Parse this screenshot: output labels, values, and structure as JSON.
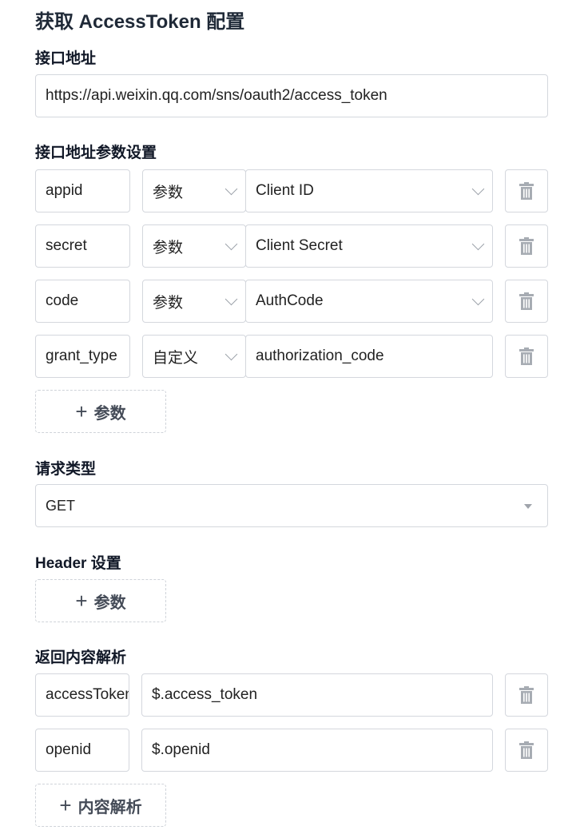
{
  "title": "获取 AccessToken 配置",
  "endpoint": {
    "label": "接口地址",
    "value": "https://api.weixin.qq.com/sns/oauth2/access_token"
  },
  "params": {
    "label": "接口地址参数设置",
    "rows": [
      {
        "key": "appid",
        "type": "参数",
        "value": "Client ID"
      },
      {
        "key": "secret",
        "type": "参数",
        "value": "Client Secret"
      },
      {
        "key": "code",
        "type": "参数",
        "value": "AuthCode"
      },
      {
        "key": "grant_type",
        "type": "自定义",
        "value": "authorization_code"
      }
    ],
    "add_label": "参数"
  },
  "request_type": {
    "label": "请求类型",
    "value": "GET"
  },
  "header": {
    "label": "Header 设置",
    "add_label": "参数"
  },
  "response": {
    "label": "返回内容解析",
    "rows": [
      {
        "key": "accessToken",
        "value": "$.access_token"
      },
      {
        "key": "openid",
        "value": "$.openid"
      }
    ],
    "add_label": "内容解析"
  },
  "icons": {
    "delete": "trash-icon",
    "select": "chevron-down-icon",
    "add": "plus-icon"
  },
  "colors": {
    "border": "#d4d7dd",
    "trash": "#a7acb3",
    "text": "#222222"
  }
}
